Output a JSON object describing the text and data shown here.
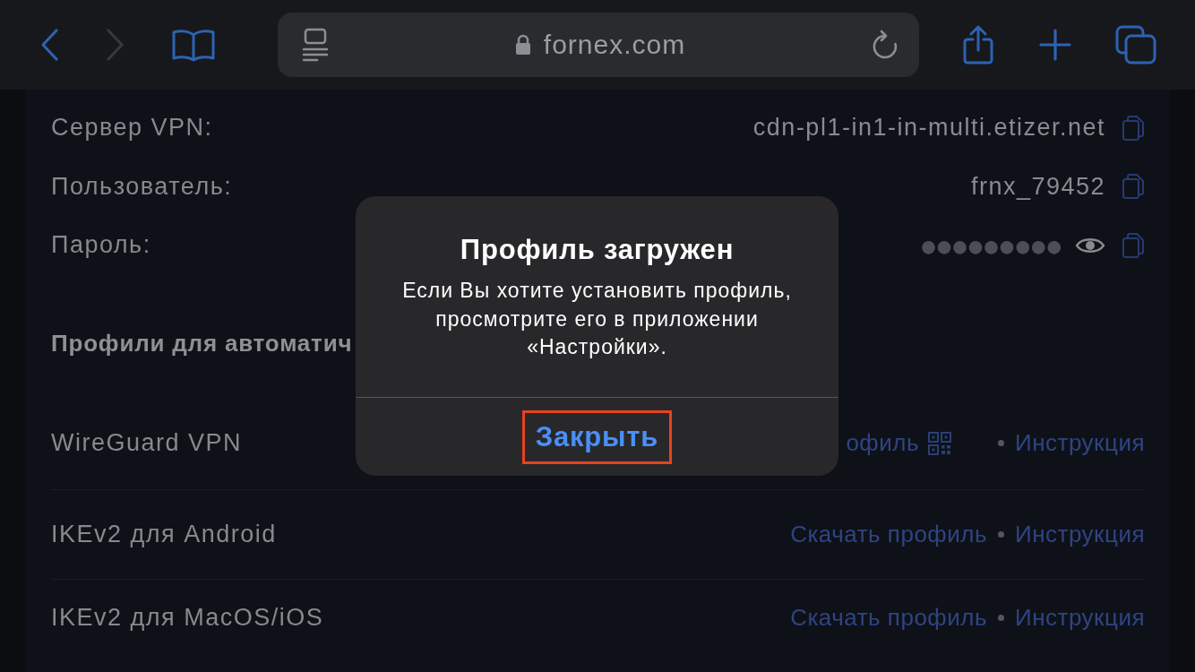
{
  "browser": {
    "left_buttons": [
      {
        "kind": "back",
        "disabled": false
      },
      {
        "kind": "forward",
        "disabled": true
      },
      {
        "kind": "bookmarks",
        "disabled": false
      }
    ],
    "address_bar": {
      "url": "fornex.com",
      "secure": true
    },
    "right_buttons": [
      {
        "kind": "share",
        "disabled": false
      },
      {
        "kind": "new_tab",
        "disabled": false
      },
      {
        "kind": "tabs",
        "disabled": false
      }
    ]
  },
  "credentials": [
    {
      "kind": "text",
      "label": "Сервер VPN:",
      "value": "cdn-pl1-in1-in-multi.etizer.net"
    },
    {
      "kind": "text",
      "label": "Пользователь:",
      "value": "frnx_79452"
    },
    {
      "kind": "password",
      "label": "Пароль:",
      "value": "●●●●●●●●●"
    }
  ],
  "section_title": "Профили для автоматич",
  "profiles": [
    {
      "name": "WireGuard VPN",
      "download": "офиль",
      "qr": true,
      "instructions": "Инструкция"
    },
    {
      "name": "IKEv2 для Android",
      "download": "Скачать профиль",
      "qr": false,
      "instructions": "Инструкция"
    },
    {
      "name": "IKEv2 для MacOS/iOS",
      "download": "Скачать профиль",
      "qr": false,
      "instructions": "Инструкция"
    }
  ],
  "alert": {
    "title": "Профиль загружен",
    "message": "Если Вы хотите установить профиль, просмотрите его в приложении «Настройки».",
    "buttons": [
      {
        "label": "Закрыть",
        "highlighted": true
      }
    ]
  }
}
